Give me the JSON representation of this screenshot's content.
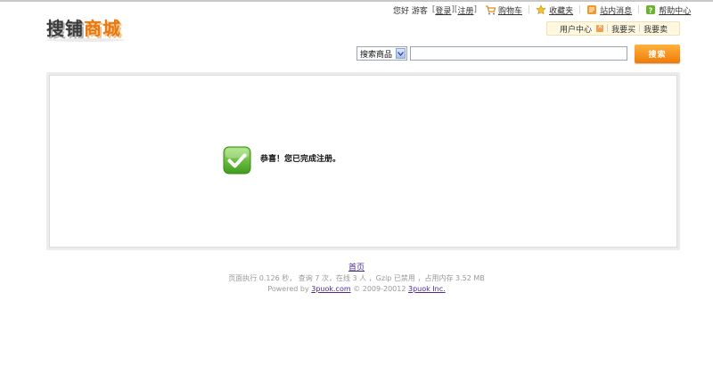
{
  "logo": {
    "part1": "搜铺",
    "part2": "商城"
  },
  "user": {
    "greeting": "您好 游客",
    "login": "登录",
    "register": "注册"
  },
  "toplinks": [
    {
      "label": "购物车",
      "icon": "cart-icon"
    },
    {
      "label": "收藏夹",
      "icon": "star-icon"
    },
    {
      "label": "站内消息",
      "icon": "message-icon"
    },
    {
      "label": "帮助中心",
      "icon": "help-icon"
    }
  ],
  "subnav": {
    "user_center": "用户中心",
    "buy": "我要买",
    "sell": "我要卖"
  },
  "search": {
    "category": "搜索商品",
    "value": "",
    "button": "搜索"
  },
  "main": {
    "message": "恭喜！您已完成注册。"
  },
  "footer": {
    "home": "首页",
    "stats": "页面执行  0.126 秒， 查询  7 次，在线  3 人 ，Gzip 已禁用  ，占用内存  3.52 MB",
    "powered_prefix": "Powered by",
    "site_link": "3puok.com",
    "copyright": "© 2009-20012",
    "company_link": "3puok Inc."
  },
  "colors": {
    "accent": "#f07a07",
    "success": "#5cb82b",
    "link": "#4b2b8f"
  }
}
